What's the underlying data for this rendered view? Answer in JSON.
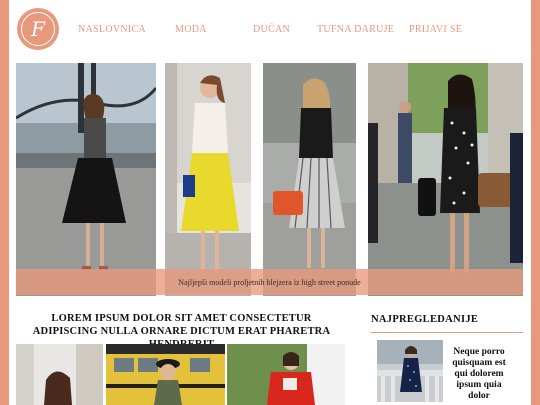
{
  "header": {
    "logo_letter": "F",
    "nav": [
      "NASLOVNICA",
      "MODA",
      "DUĆAN",
      "TUFNA DARUJE",
      "PRIJAVI SE"
    ]
  },
  "hero": {
    "caption": "Najljepši modeli proljetnih blejzera iz high street ponude"
  },
  "main": {
    "title": "LOREM IPSUM DOLOR SIT AMET CONSECTETUR ADIPISCING NULLA ORNARE DICTUM ERAT PHARETRA HENDRERIT"
  },
  "sidebar": {
    "title": "NAJPREGLEDANIJE",
    "item_text": "Neque porro quisquam est qui dolorem ipsum quia dolor"
  },
  "colors": {
    "accent": "#e8987c"
  }
}
